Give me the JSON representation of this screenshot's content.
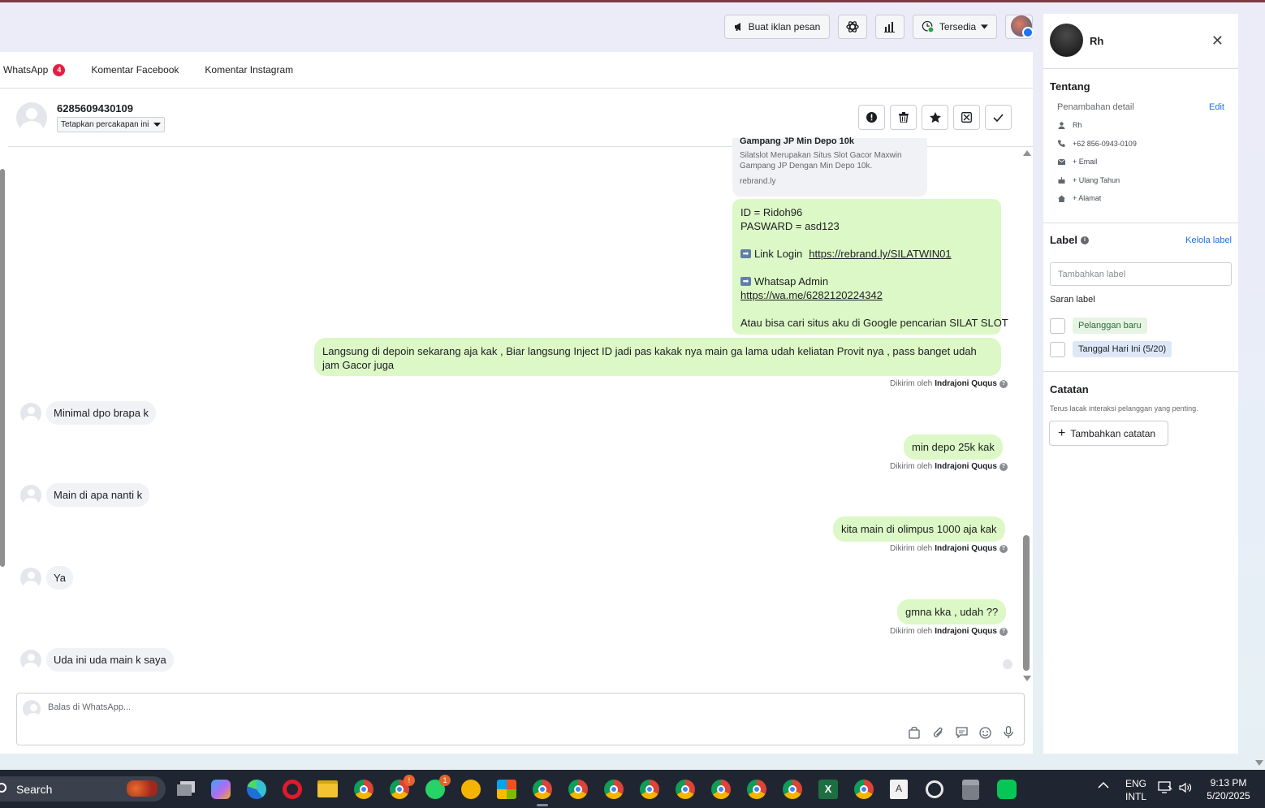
{
  "toolbar": {
    "create_ad_label": "Buat iklan pesan",
    "status_label": "Tersedia"
  },
  "tabs": [
    {
      "label": "WhatsApp",
      "badge": "4"
    },
    {
      "label": "Komentar Facebook"
    },
    {
      "label": "Komentar Instagram"
    }
  ],
  "conversation": {
    "phone": "6285609430109",
    "assign_label": "Tetapkan percakapan ini"
  },
  "link_preview": {
    "title": "Gampang JP Min Depo 10k",
    "description": "Silatslot Merupakan Situs Slot Gacor Maxwin Gampang JP Dengan Min Depo 10k.",
    "domain": "rebrand.ly"
  },
  "messages": {
    "info_bubble": {
      "id_line": "ID = Ridoh96",
      "password_line": "PASWARD = asd123",
      "login_label": "Link Login",
      "login_url": "https://rebrand.ly/SILATWIN01",
      "admin_label": "Whatsap Admin",
      "admin_url": "https://wa.me/6282120224342",
      "footer": "Atau bisa cari situs aku di Google pencarian SILAT SLOT"
    },
    "out1": "Langsung di depoin sekarang aja kak , Biar langsung Inject ID jadi pas kakak nya main ga lama udah keliatan Provit nya , pass banget udah jam Gacor juga",
    "in1": "Minimal dpo brapa k",
    "out2": "min depo 25k kak",
    "in2": "Main di apa nanti k",
    "out3": "kita main di olimpus 1000 aja kak",
    "in3": "Ya",
    "out4": "gmna kka , udah ??",
    "in4": "Uda ini uda main k saya",
    "sent_by_prefix": "Dikirim oleh",
    "sent_by_name": "Indrajoni Ququs"
  },
  "composer": {
    "placeholder": "Balas di WhatsApp..."
  },
  "contact_panel": {
    "name": "Rh",
    "about_title": "Tentang",
    "added_details": "Penambahan detail",
    "edit_label": "Edit",
    "details": {
      "name": "Rh",
      "phone": "+62 856-0943-0109",
      "email": "+ Email",
      "birthday": "+ Ulang Tahun",
      "address": "+ Alamat"
    },
    "label_title": "Label",
    "manage_labels": "Kelola label",
    "label_placeholder": "Tambahkan label",
    "suggested_title": "Saran label",
    "suggested_labels": [
      {
        "text": "Pelanggan baru",
        "color": "#e6f4e2"
      },
      {
        "text": "Tanggal Hari Ini (5/20)",
        "color": "#dce8f7"
      }
    ],
    "notes_title": "Catatan",
    "notes_desc": "Terus lacak interaksi pelanggan yang penting.",
    "add_note_label": "Tambahkan catatan"
  },
  "taskbar": {
    "search_label": "Search",
    "lang_top": "ENG",
    "lang_bottom": "INTL",
    "time": "9:13 PM",
    "date": "5/20/2025",
    "badges": {
      "chrome2": "!",
      "whatsapp": "1"
    }
  }
}
